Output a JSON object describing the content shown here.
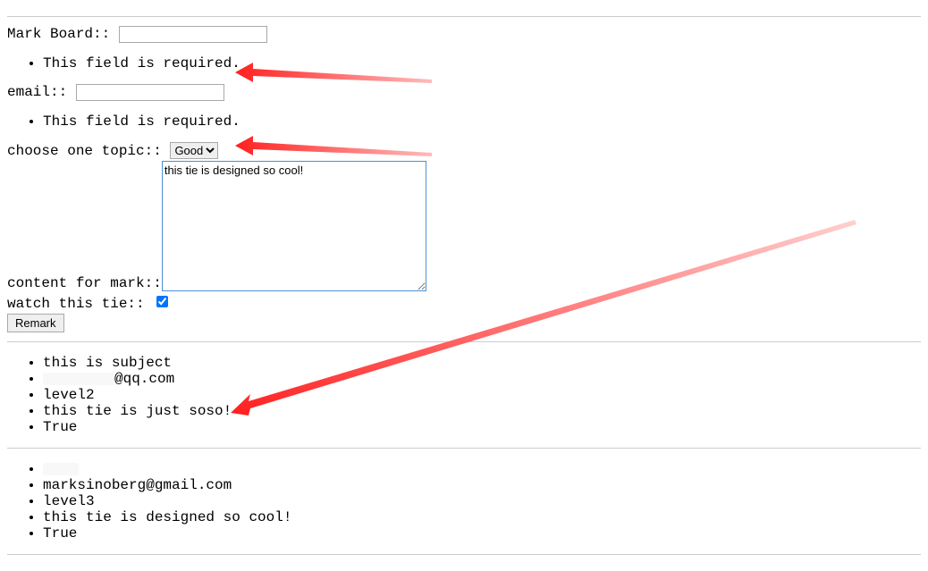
{
  "form": {
    "markBoard": {
      "label": "Mark Board::",
      "value": ""
    },
    "email": {
      "label": "email::",
      "value": ""
    },
    "topic": {
      "label": "choose one topic::",
      "selected": "Good"
    },
    "content": {
      "label": "content for mark::",
      "value": "this tie is designed so cool!"
    },
    "watch": {
      "label": "watch this tie::",
      "checked": true
    },
    "submit": "Remark",
    "errors": {
      "markBoard": "This field is required.",
      "email": "This field is required."
    }
  },
  "records": [
    {
      "subject": "this is subject",
      "email_prefix_redacted": true,
      "email_suffix": "@qq.com",
      "level": "level2",
      "content": "this tie is just soso!",
      "watched": "True"
    },
    {
      "subject_redacted": true,
      "email": "marksinoberg@gmail.com",
      "level": "level3",
      "content": "this tie is designed so cool!",
      "watched": "True"
    }
  ]
}
